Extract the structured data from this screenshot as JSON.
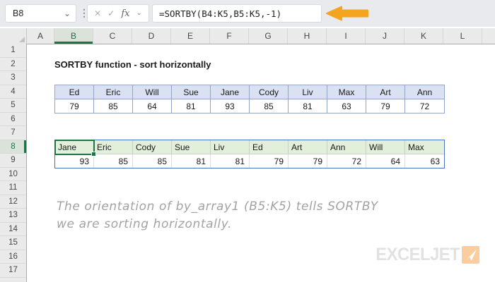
{
  "formula_bar": {
    "name_box": "B8",
    "formula": "=SORTBY(B4:K5,B5:K5,-1)"
  },
  "icons": {
    "chevron_down": "⌄",
    "cancel": "✕",
    "enter": "✓",
    "fx": "fx",
    "dots": "⋮"
  },
  "grid": {
    "column_headers": [
      "A",
      "B",
      "C",
      "D",
      "E",
      "F",
      "G",
      "H",
      "I",
      "J",
      "K",
      "L"
    ],
    "selected_column": "B",
    "row_headers": [
      "1",
      "2",
      "3",
      "4",
      "5",
      "6",
      "7",
      "8",
      "9",
      "10",
      "11",
      "12",
      "13",
      "14",
      "15",
      "16",
      "17"
    ],
    "selected_row": "8",
    "active_cell": "B8"
  },
  "sheet": {
    "title": "SORTBY function - sort horizontally",
    "source_table": {
      "range": "B4:K5",
      "names": [
        "Ed",
        "Eric",
        "Will",
        "Sue",
        "Jane",
        "Cody",
        "Liv",
        "Max",
        "Art",
        "Ann"
      ],
      "values": [
        79,
        85,
        64,
        81,
        93,
        85,
        81,
        63,
        79,
        72
      ]
    },
    "result_table": {
      "range": "B8:K9",
      "names": [
        "Jane",
        "Eric",
        "Cody",
        "Sue",
        "Liv",
        "Ed",
        "Art",
        "Ann",
        "Will",
        "Max"
      ],
      "values": [
        93,
        85,
        85,
        81,
        81,
        79,
        79,
        72,
        64,
        63
      ]
    },
    "annotation_line1": "The orientation of by_array1 (B5:K5) tells SORTBY",
    "annotation_line2": "we are sorting horizontally."
  },
  "logo": {
    "text": "EXCELJET"
  },
  "colors": {
    "accent_green": "#217346",
    "table1_header_bg": "#D9E1F2",
    "table1_border": "#95A5C6",
    "table2_header_bg": "#E2EFDA",
    "spill_border": "#4472C4",
    "arrow_orange": "#F5A41F",
    "annotation_gray": "#A2A2A2",
    "logo_text": "#E2E2E2",
    "logo_square": "#F9CD9E"
  }
}
